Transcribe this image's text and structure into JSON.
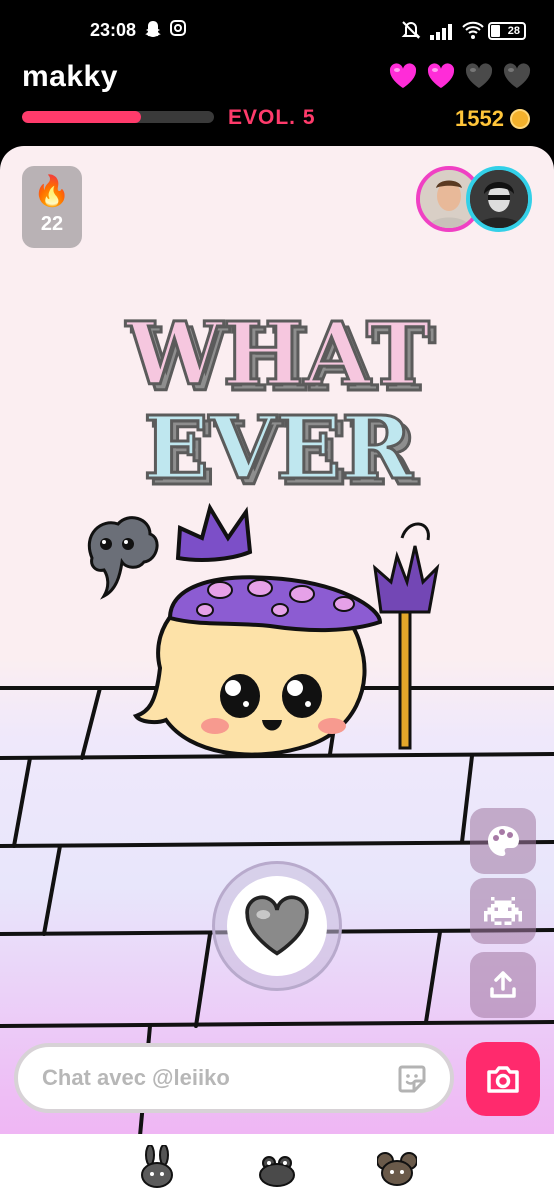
{
  "status": {
    "time": "23:08",
    "battery": "28"
  },
  "header": {
    "username": "makky",
    "hearts_total": 4,
    "hearts_filled": 2,
    "evolution_label": "EVOL. 5",
    "evolution_progress": 0.62,
    "coins": "1552"
  },
  "streak": {
    "icon": "fire-icon",
    "count": "22"
  },
  "pet": {
    "sticker_text": "WHATEVER"
  },
  "chat": {
    "placeholder": "Chat avec @leiiko"
  },
  "side_actions": [
    "palette-icon",
    "space-invader-icon",
    "share-upload-icon"
  ],
  "colors": {
    "accent_pink": "#ff3b6b",
    "coin_gold": "#ffc53a",
    "heart_magenta": "#ff2cd8",
    "camera_pink": "#ff2a6d"
  },
  "bottom_nav": [
    "bunny-icon",
    "frog-icon",
    "mouse-icon"
  ]
}
